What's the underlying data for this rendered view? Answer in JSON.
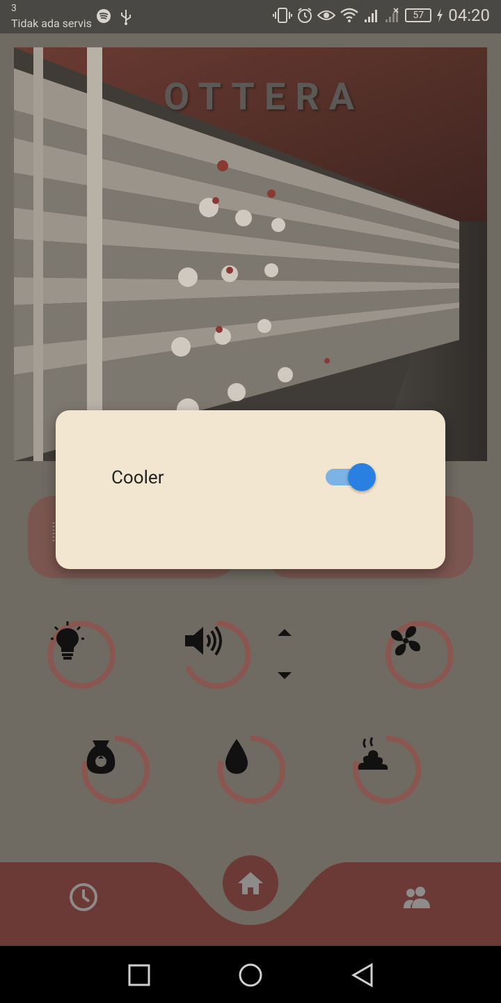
{
  "statusbar": {
    "notification_count": "3",
    "carrier": "Tidak ada servis",
    "battery": "57",
    "time": "04:20",
    "left_icons": [
      "spotify-icon",
      "usb-icon"
    ],
    "right_icons": [
      "vibrate-icon",
      "alarm-icon",
      "eye-icon",
      "wifi-icon",
      "signal-icon",
      "signal-off-icon",
      "battery-icon",
      "charging-icon"
    ]
  },
  "header": {
    "title": "OTTERA"
  },
  "dialog": {
    "label": "Cooler",
    "toggle_on": true
  },
  "controls": {
    "row1": [
      "lightbulb-icon",
      "speaker-icon",
      "fan-icon"
    ],
    "row2": [
      "feed-bag-icon",
      "water-drop-icon",
      "manure-icon"
    ]
  },
  "bottom_nav": [
    "history-icon",
    "home-icon",
    "users-icon"
  ],
  "colors": {
    "accent_ring": "#8a5650",
    "nav_bar": "#6b3a37",
    "dialog_bg": "#f2e6d0",
    "toggle": "#2a80e0"
  }
}
